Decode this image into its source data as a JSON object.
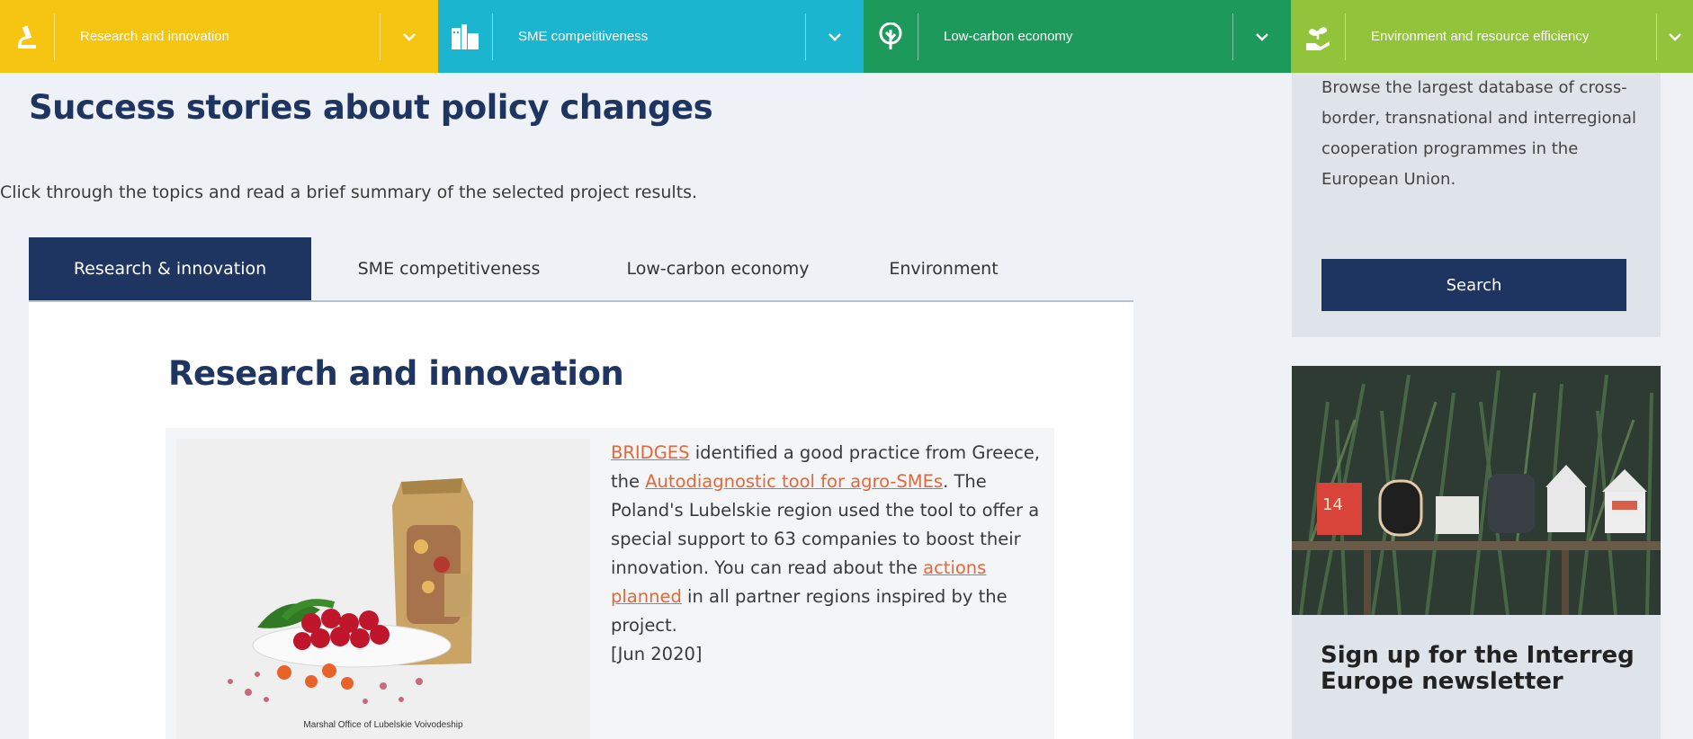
{
  "nav": {
    "items": [
      {
        "label": "Research and innovation",
        "icon": "microscope-icon",
        "color": "#f6c511"
      },
      {
        "label": "SME competitiveness",
        "icon": "buildings-icon",
        "color": "#1cb5cf"
      },
      {
        "label": "Low-carbon economy",
        "icon": "tree-icon",
        "color": "#1d9a5b"
      },
      {
        "label": "Environment and resource efficiency",
        "icon": "hand-plant-icon",
        "color": "#91c43a"
      }
    ]
  },
  "main": {
    "title": "Success stories about policy changes",
    "intro": "Click through the topics and read a brief summary of the selected project results.",
    "tabs": [
      {
        "label": "Research & innovation",
        "active": true
      },
      {
        "label": "SME competitiveness",
        "active": false
      },
      {
        "label": "Low-carbon economy",
        "active": false
      },
      {
        "label": "Environment",
        "active": false
      }
    ],
    "section_title": "Research and innovation",
    "story": {
      "image_caption": "Marshal Office of Lubelskie Voivodeship",
      "link1": "BRIDGES",
      "text1": " identified a good practice from Greece, the ",
      "link2": "Autodiagnostic tool for agro-SMEs",
      "text2": ". The Poland's Lubelskie region used the tool to offer a special support to 63 companies to boost their innovation. You can read about the ",
      "link3": "actions planned",
      "text3": " in all partner regions inspired by the project.",
      "date": "[Jun 2020]"
    }
  },
  "sidebar": {
    "description": "Browse the largest database of cross-border, transnational and interregional cooperation programmes in the European Union.",
    "search_label": "Search",
    "newsletter_title": "Sign up for the Interreg Europe newsletter",
    "mailbox_number": "14"
  },
  "colors": {
    "navy": "#1e3461",
    "link": "#e2683c",
    "background": "#eef2f6"
  }
}
